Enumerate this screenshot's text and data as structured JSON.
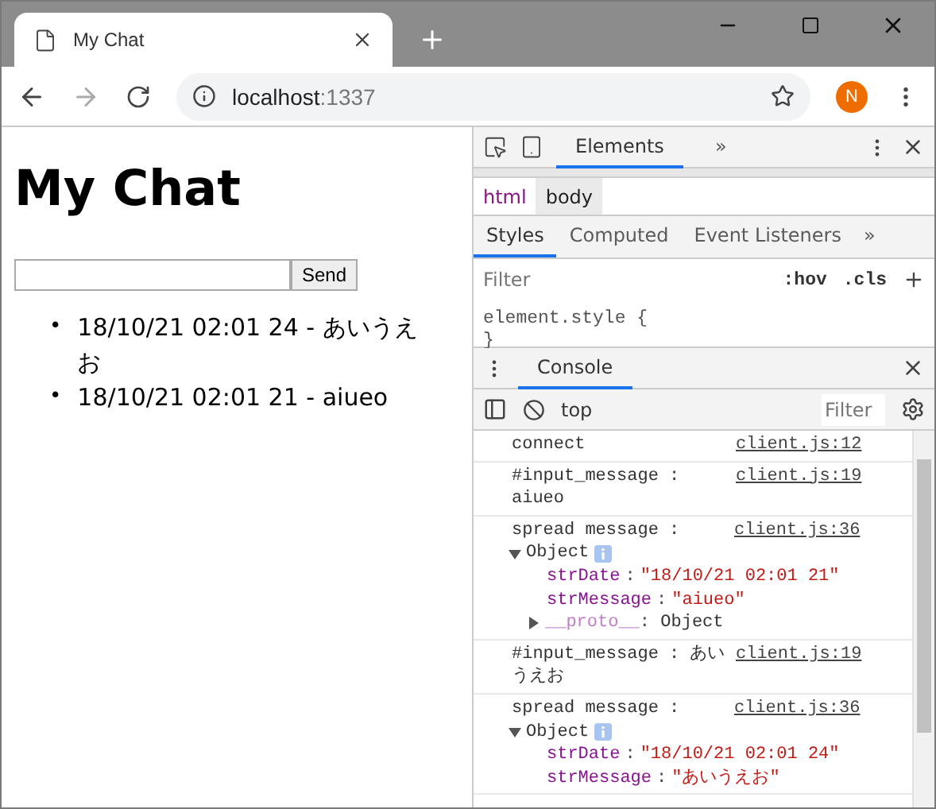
{
  "browser": {
    "tab_title": "My Chat",
    "url_host": "localhost",
    "url_port": ":1337",
    "avatar_letter": "N"
  },
  "page": {
    "title": "My Chat",
    "send_button": "Send",
    "messages": [
      {
        "bullet": "•",
        "text": "18/10/21 02:01 24 - あいうえお"
      },
      {
        "bullet": "•",
        "text": "18/10/21 02:01 21 - aiueo"
      }
    ]
  },
  "devtools": {
    "tabs": [
      {
        "label": "Elements",
        "selected": true
      }
    ],
    "more": "»",
    "breadcrumbs": [
      {
        "label": "html",
        "selected": false
      },
      {
        "label": "body",
        "selected": true
      }
    ],
    "style_tabs": [
      {
        "label": "Styles",
        "selected": true
      },
      {
        "label": "Computed",
        "selected": false
      },
      {
        "label": "Event Listeners",
        "selected": false
      }
    ],
    "style_more": "»",
    "styles_filter": {
      "placeholder": "Filter"
    },
    "hov": ":hov",
    "cls": ".cls",
    "rule_open": "element.style {",
    "rule_close": "}",
    "drawer_tabs": [
      {
        "label": "Console",
        "selected": true
      }
    ],
    "context": "top",
    "console_filter": {
      "placeholder": "Filter"
    },
    "console": [
      {
        "kind": "log",
        "text": "connect",
        "source": "client.js:12"
      },
      {
        "kind": "log",
        "text": "#input_message : aiueo",
        "source": "client.js:19"
      },
      {
        "kind": "object",
        "text": "spread message :",
        "source": "client.js:36",
        "object_label": "Object",
        "expanded": true,
        "properties": [
          {
            "key": "strDate",
            "sep": ":",
            "value": "\"18/10/21 02:01 21\""
          },
          {
            "key": "strMessage",
            "sep": ":",
            "value": "\"aiueo\""
          }
        ],
        "proto": {
          "key": "__proto__",
          "sep": ":",
          "value": "Object",
          "expanded": false
        }
      },
      {
        "kind": "log",
        "text": "#input_message : あいうえお",
        "source": "client.js:19"
      },
      {
        "kind": "object",
        "text": "spread message :",
        "source": "client.js:36",
        "object_label": "Object",
        "expanded": true,
        "properties": [
          {
            "key": "strDate",
            "sep": ":",
            "value": "\"18/10/21 02:01 24\""
          },
          {
            "key": "strMessage",
            "sep": ":",
            "value": "\"あいうえお\""
          }
        ]
      }
    ]
  }
}
